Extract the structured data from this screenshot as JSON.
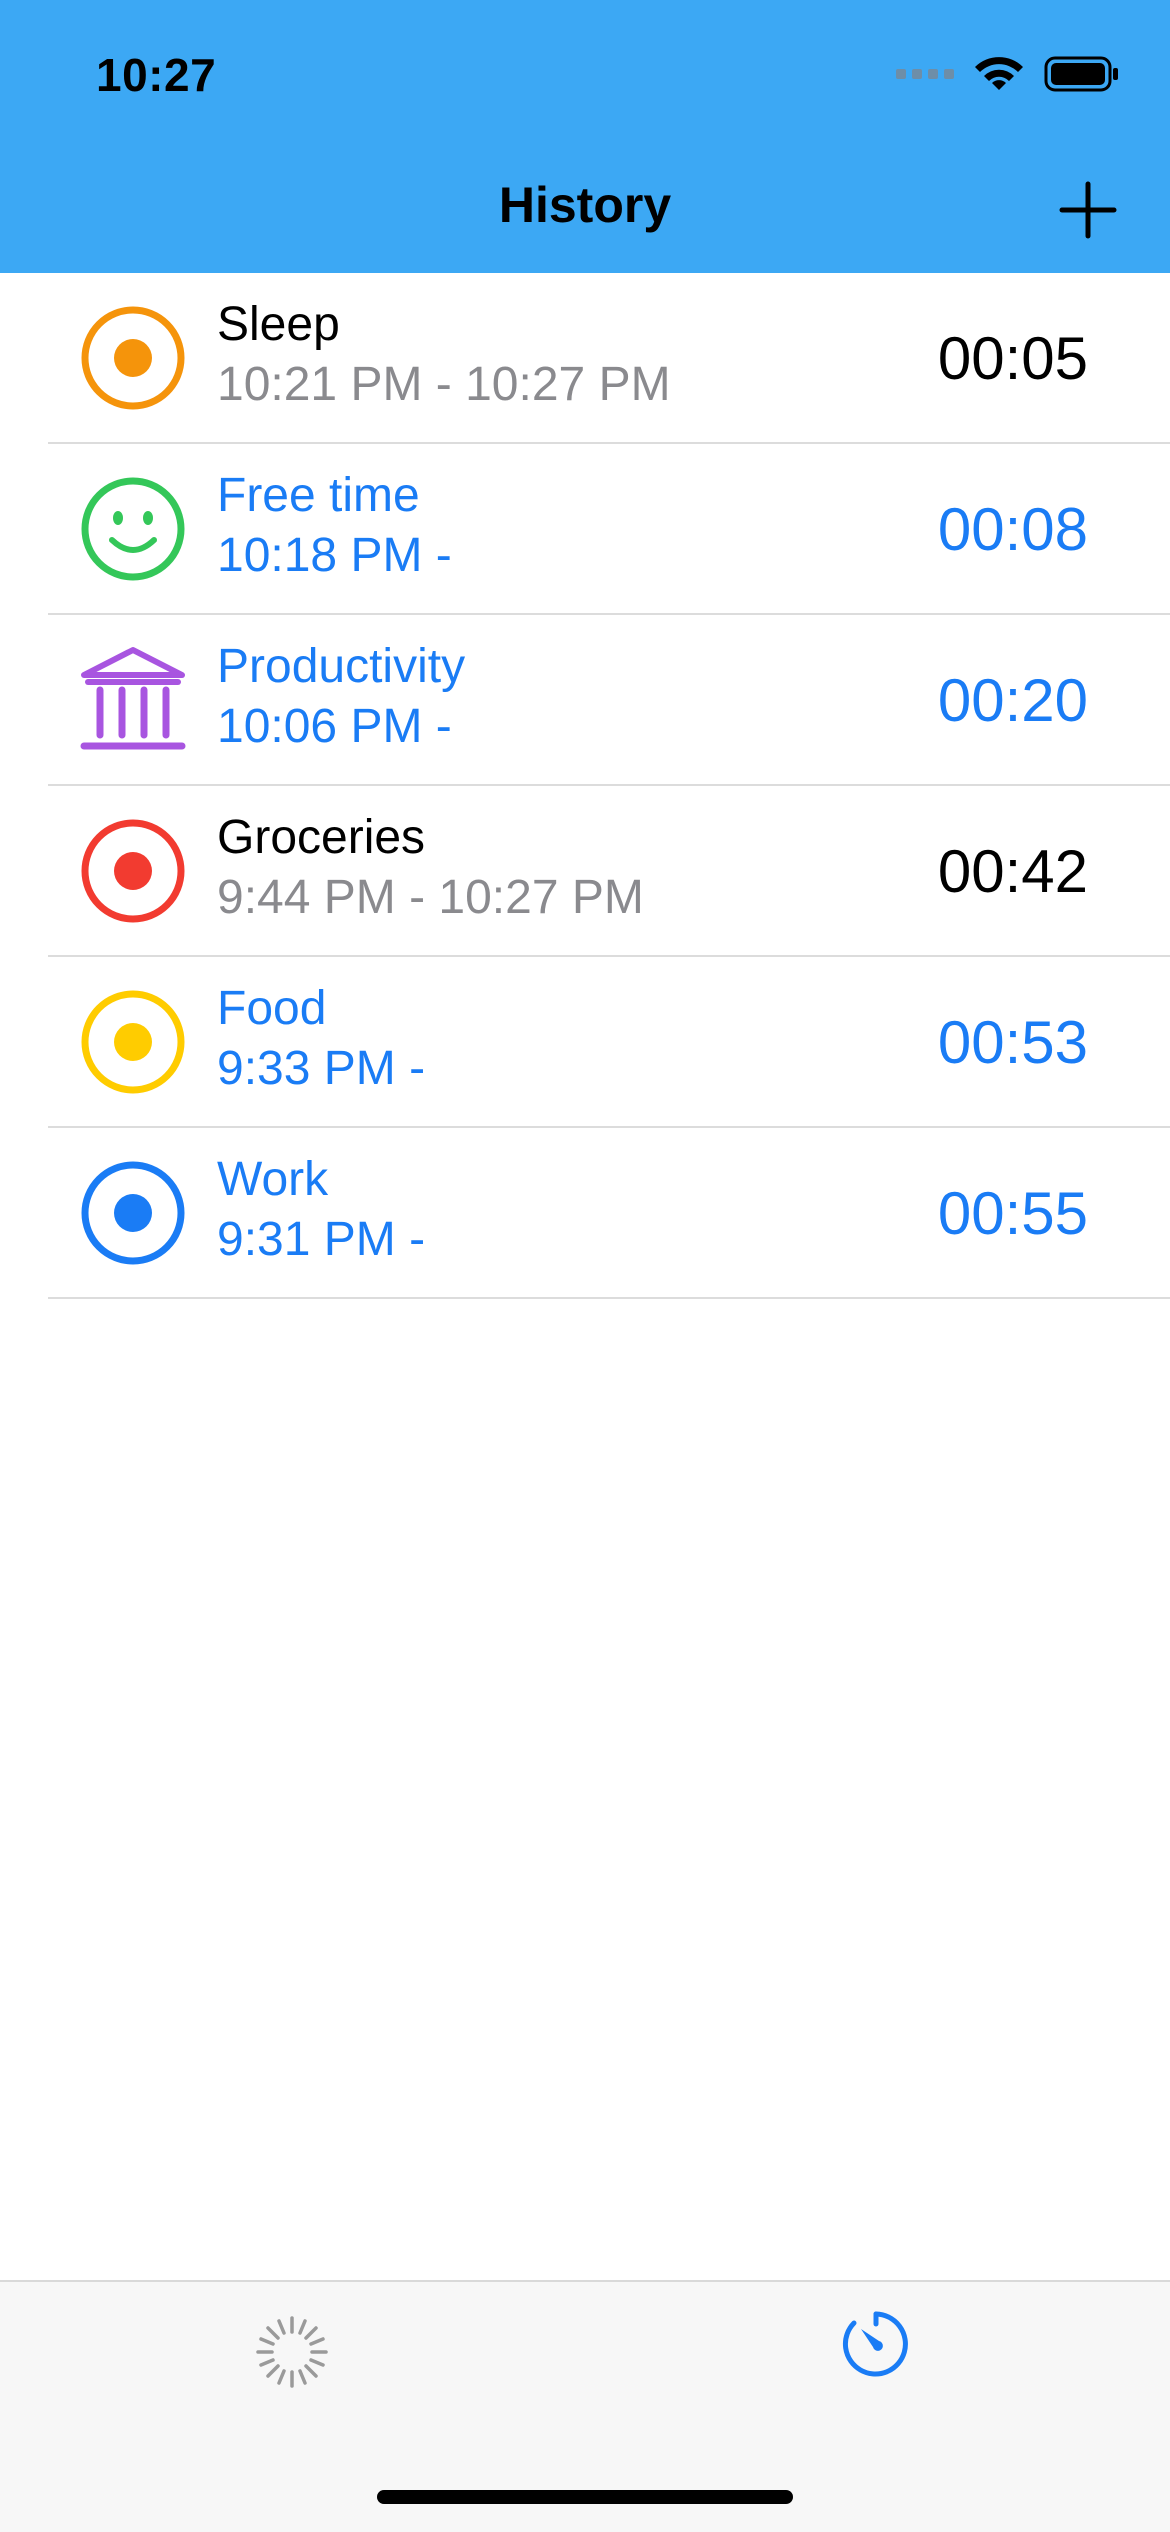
{
  "status_bar": {
    "time": "10:27"
  },
  "nav": {
    "title": "History",
    "add_icon": "plus-icon"
  },
  "entries": [
    {
      "name": "Sleep",
      "time_range": "10:21 PM - 10:27 PM",
      "duration": "00:05",
      "state": "completed",
      "icon": "target-icon",
      "color": "#f5940b"
    },
    {
      "name": "Free time",
      "time_range": "10:18 PM -",
      "duration": "00:08",
      "state": "active",
      "icon": "smiley-icon",
      "color": "#34c759"
    },
    {
      "name": "Productivity",
      "time_range": "10:06 PM -",
      "duration": "00:20",
      "state": "active",
      "icon": "bank-icon",
      "color": "#a855e0"
    },
    {
      "name": "Groceries",
      "time_range": "9:44 PM - 10:27 PM",
      "duration": "00:42",
      "state": "completed",
      "icon": "target-icon",
      "color": "#f23b30"
    },
    {
      "name": "Food",
      "time_range": "9:33 PM -",
      "duration": "00:53",
      "state": "active",
      "icon": "target-icon",
      "color": "#ffcc00"
    },
    {
      "name": "Work",
      "time_range": "9:31 PM -",
      "duration": "00:55",
      "state": "active",
      "icon": "target-icon",
      "color": "#1a7cf5"
    }
  ],
  "tab_bar": {
    "tabs": [
      {
        "icon": "loading-spinner-icon"
      },
      {
        "icon": "timer-icon",
        "selected": true
      }
    ]
  },
  "colors": {
    "header_background": "#3ca8f4",
    "active_text": "#1a7cf5",
    "secondary_text": "#8a8a8e"
  }
}
